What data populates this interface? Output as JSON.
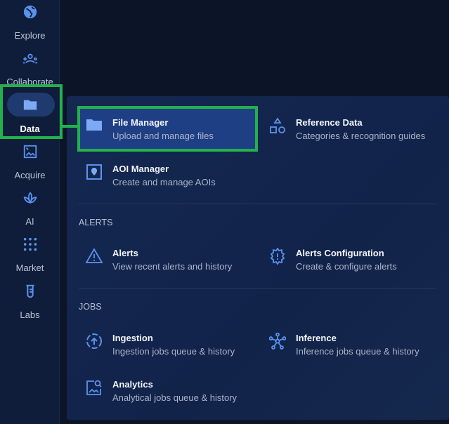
{
  "sidebar": {
    "items": [
      {
        "label": "Explore",
        "icon": "globe-icon"
      },
      {
        "label": "Collaborate",
        "icon": "users-icon"
      },
      {
        "label": "Data",
        "icon": "folder-icon",
        "active": true
      },
      {
        "label": "Acquire",
        "icon": "image-icon"
      },
      {
        "label": "AI",
        "icon": "lotus-icon"
      },
      {
        "label": "Market",
        "icon": "grid-icon"
      },
      {
        "label": "Labs",
        "icon": "flask-icon"
      }
    ]
  },
  "menu": {
    "data_items": [
      {
        "title": "File Manager",
        "desc": "Upload and manage files",
        "icon": "folder-icon"
      },
      {
        "title": "Reference Data",
        "desc": "Categories & recognition guides",
        "icon": "shapes-icon"
      },
      {
        "title": "AOI Manager",
        "desc": "Create and manage AOIs",
        "icon": "map-pin-icon"
      }
    ],
    "alerts_heading": "ALERTS",
    "alerts_items": [
      {
        "title": "Alerts",
        "desc": "View recent alerts and history",
        "icon": "warning-icon"
      },
      {
        "title": "Alerts Configuration",
        "desc": "Create & configure alerts",
        "icon": "gear-alert-icon"
      }
    ],
    "jobs_heading": "JOBS",
    "jobs_items": [
      {
        "title": "Ingestion",
        "desc": "Ingestion jobs queue & history",
        "icon": "upload-circle-icon"
      },
      {
        "title": "Inference",
        "desc": "Inference jobs queue & history",
        "icon": "network-icon"
      },
      {
        "title": "Analytics",
        "desc": "Analytical jobs queue & history",
        "icon": "image-search-icon"
      }
    ]
  },
  "colors": {
    "accent": "#4f8bea",
    "highlight": "#22b14c",
    "active_bg": "#1f3f85"
  }
}
